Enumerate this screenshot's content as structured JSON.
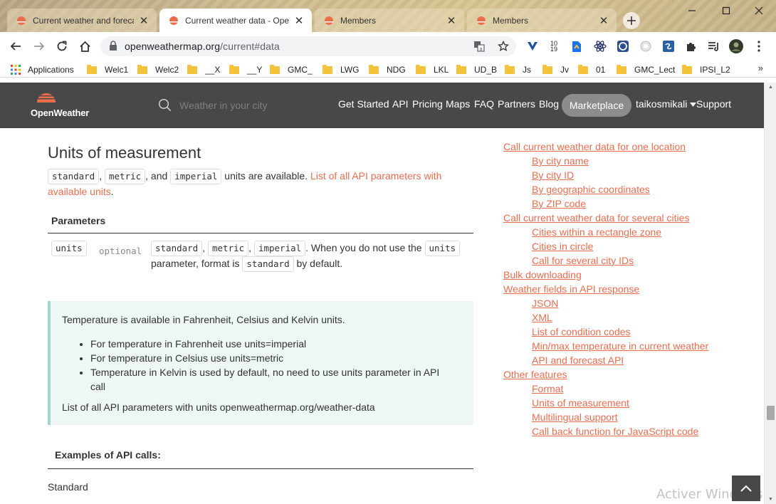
{
  "tabs": [
    {
      "title": "Current weather and forecast",
      "close": "✕"
    },
    {
      "title": "Current weather data - OpenWeatherMap",
      "close": "✕"
    },
    {
      "title": "Members",
      "close": "✕"
    },
    {
      "title": "Members",
      "close": "✕"
    }
  ],
  "address_bar": {
    "host": "openweathermap.org",
    "path": "/current#data"
  },
  "bookmarks": {
    "apps_label": "Applications",
    "folders": [
      "Welc1",
      "Welc2",
      "__X",
      "__Y",
      "GMC_",
      "LWG",
      "NDG",
      "LKL",
      "UD_B",
      "Js",
      "Jv",
      "01",
      "GMC_Lect",
      "IPSI_L2"
    ],
    "more": "»"
  },
  "extension_badge": "10 19",
  "site": {
    "brand": "OpenWeather",
    "search_placeholder": "Weather in your city",
    "nav": [
      "Get Started",
      "API",
      "Pricing",
      "Maps",
      "FAQ",
      "Partners",
      "Blog"
    ],
    "marketplace": "Marketplace",
    "user": "taikosmikali",
    "support": "Support"
  },
  "content": {
    "heading": "Units of measurement",
    "units": [
      "standard",
      "metric",
      "imperial"
    ],
    "intro_sep1": ",",
    "intro_and": ", and",
    "intro_text": "units are available.",
    "intro_link": "List of all API parameters with available units",
    "intro_end": ".",
    "params_heading": "Parameters",
    "param_name": "units",
    "param_optional": "optional",
    "param_text1": ". When you do not use the",
    "param_text2": "parameter, format is",
    "param_text3": "by default.",
    "info_text": "Temperature is available in Fahrenheit, Celsius and Kelvin units.",
    "info_bullets": [
      "For temperature in Fahrenheit use units=imperial",
      "For temperature in Celsius use units=metric",
      "Temperature in Kelvin is used by default, no need to use units parameter in API call"
    ],
    "info_footer": "List of all API parameters with units openweathermap.org/weather-data",
    "examples_heading": "Examples of API calls:",
    "standard_label": "Standard"
  },
  "toc": [
    {
      "label": "Call current weather data for one location",
      "level": 0
    },
    {
      "label": "By city name",
      "level": 1
    },
    {
      "label": "By city ID",
      "level": 1
    },
    {
      "label": "By geographic coordinates",
      "level": 1
    },
    {
      "label": "By ZIP code",
      "level": 1
    },
    {
      "label": "Call current weather data for several cities",
      "level": 0
    },
    {
      "label": "Cities within a rectangle zone",
      "level": 1
    },
    {
      "label": "Cities in circle",
      "level": 1
    },
    {
      "label": "Call for several city IDs",
      "level": 1
    },
    {
      "label": "Bulk downloading",
      "level": 0
    },
    {
      "label": "Weather fields in API response",
      "level": 0
    },
    {
      "label": "JSON",
      "level": 1
    },
    {
      "label": "XML",
      "level": 1
    },
    {
      "label": "List of condition codes",
      "level": 1
    },
    {
      "label": "Min/max temperature in current weather",
      "level": 1
    },
    {
      "label": "API and forecast API",
      "level": 1
    },
    {
      "label": "Other features",
      "level": 0
    },
    {
      "label": "Format",
      "level": 1
    },
    {
      "label": "Units of measurement",
      "level": 1
    },
    {
      "label": "Multilingual support",
      "level": 1
    },
    {
      "label": "Call back function for JavaScript code",
      "level": 1
    }
  ],
  "watermark": "Activer Windows",
  "colors": {
    "accent": "#e96e50",
    "nav_bg": "#48484a",
    "info_bg": "#eef7f6",
    "info_border": "#9fd5cd"
  }
}
